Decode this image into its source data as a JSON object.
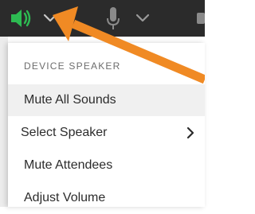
{
  "toolbar": {
    "speaker_icon": "speaker-on-icon",
    "speaker_color": "#2dbb52",
    "dropdown_icon": "chevron-down-icon",
    "mic_icon": "microphone-icon",
    "mic_dropdown_icon": "chevron-down-icon"
  },
  "menu": {
    "header": "DEVICE SPEAKER",
    "items": [
      {
        "label": "Mute All Sounds",
        "highlighted": true
      },
      {
        "label": "Select Speaker",
        "has_submenu": true
      },
      {
        "label": "Mute Attendees"
      },
      {
        "label": "Adjust Volume"
      }
    ]
  },
  "annotation": {
    "arrow_color": "#f08a24"
  }
}
